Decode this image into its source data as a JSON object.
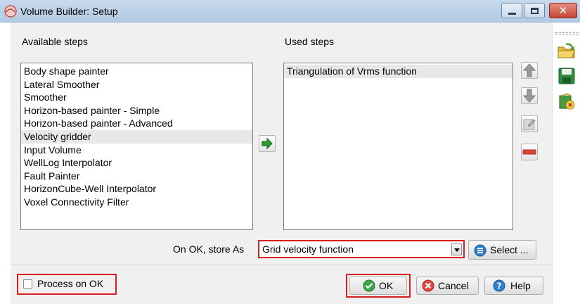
{
  "window": {
    "title": "Volume Builder: Setup"
  },
  "available": {
    "label": "Available steps",
    "items": [
      "Body shape painter",
      "Lateral Smoother",
      "Smoother",
      "Horizon-based painter - Simple",
      "Horizon-based painter - Advanced",
      "Velocity gridder",
      "Input Volume",
      "WellLog Interpolator",
      "Fault Painter",
      "HorizonCube-Well Interpolator",
      "Voxel Connectivity Filter"
    ],
    "selected_index": 5
  },
  "used": {
    "label": "Used steps",
    "items": [
      "Triangulation of Vrms function"
    ]
  },
  "store": {
    "label": "On OK, store As",
    "value": "Grid velocity function",
    "select_label": "Select ..."
  },
  "options": {
    "process_on_ok_label": "Process on OK",
    "process_on_ok_checked": false
  },
  "buttons": {
    "ok": "OK",
    "cancel": "Cancel",
    "help": "Help"
  },
  "icons": {
    "app": "volume-builder-app-icon",
    "add_step": "green-arrow-right-icon",
    "move_up": "arrow-up-icon",
    "move_down": "arrow-down-icon",
    "edit": "edit-step-icon",
    "remove": "remove-step-icon",
    "open": "open-folder-icon",
    "save": "save-disk-icon",
    "manage": "manage-setups-icon"
  },
  "colors": {
    "highlight_box": "#d81e1e",
    "titlebar": "#b9cfe6"
  }
}
